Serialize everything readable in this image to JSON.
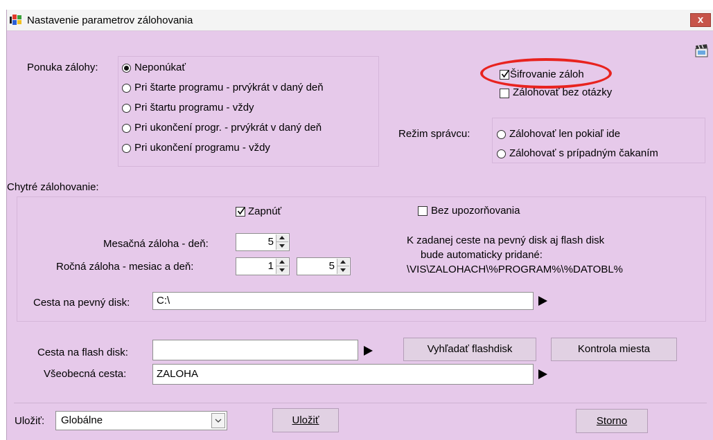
{
  "window": {
    "title": "Nastavenie parametrov zálohovania",
    "close_label": "x"
  },
  "offer": {
    "label": "Ponuka zálohy:",
    "options": [
      {
        "label": "Neponúkať",
        "selected": true
      },
      {
        "label": "Pri štarte programu - prvýkrát v daný deň",
        "selected": false
      },
      {
        "label": "Pri štartu programu - vždy",
        "selected": false
      },
      {
        "label": "Pri ukončení progr. - prvýkrát v daný deň",
        "selected": false
      },
      {
        "label": "Pri ukončení programu - vždy",
        "selected": false
      }
    ]
  },
  "encryption": {
    "label": "Šifrovanie záloh",
    "checked": true
  },
  "no_question": {
    "label": "Zálohovať bez otázky",
    "checked": false
  },
  "admin_mode": {
    "label": "Režim správcu:",
    "options": [
      {
        "label": "Zálohovať len pokiaľ ide",
        "selected": false
      },
      {
        "label": "Zálohovať s prípadným čakaním",
        "selected": false
      }
    ]
  },
  "smart": {
    "label": "Chytré zálohovanie:",
    "enable": {
      "label": "Zapnúť",
      "checked": true
    },
    "no_warnings": {
      "label": "Bez upozorňovania",
      "checked": false
    },
    "monthly": {
      "label": "Mesačná záloha - deň:",
      "value": "5"
    },
    "yearly": {
      "label": "Ročná záloha - mesiac a deň:",
      "month": "1",
      "day": "5"
    },
    "info": [
      "K zadanej ceste na pevný disk aj flash disk",
      "bude automaticky pridané:",
      "\\VIS\\ZALOHACH\\%PROGRAM%\\%DATOBL%"
    ],
    "hdd_path": {
      "label": "Cesta na pevný disk:",
      "value": "C:\\"
    }
  },
  "flash_path": {
    "label": "Cesta na flash disk:",
    "value": ""
  },
  "general_path": {
    "label": "Všeobecná cesta:",
    "value": "ZALOHA"
  },
  "buttons": {
    "find_flash": "Vyhľadať flashdisk",
    "check_space": "Kontrola miesta",
    "save": "Uložiť",
    "cancel": "Storno"
  },
  "save_scope": {
    "label": "Uložiť:",
    "value": "Globálne"
  },
  "colors": {
    "window_bg": "#e6c9ea",
    "highlight_ellipse": "#e8231f",
    "close_button": "#c7544a"
  },
  "icons": {
    "app": "windows-flag-icon",
    "help": "clapperboard-icon",
    "play": "play-arrow-icon"
  }
}
